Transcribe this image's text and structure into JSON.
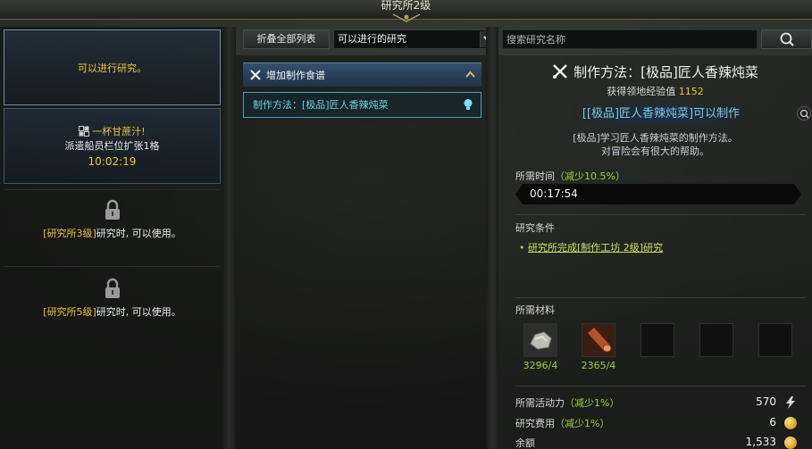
{
  "window": {
    "title": "研究所2级"
  },
  "left_panel": {
    "slot1": {
      "text": "可以进行研究。"
    },
    "slot2": {
      "title": "一杯甘蔗汁!",
      "desc": "派遣船员栏位扩张1格",
      "timer": "10:02:19"
    },
    "slot3": {
      "highlight": "[研究所3级]",
      "text": "研究时, 可以使用。"
    },
    "slot4": {
      "highlight": "[研究所5级]",
      "text": "研究时, 可以使用。"
    }
  },
  "toolbar": {
    "collapse_label": "折叠全部列表",
    "filter_value": "可以进行的研究",
    "search_placeholder": "搜索研究名称"
  },
  "list": {
    "category": "增加制作食谱",
    "items": [
      {
        "label": "制作方法：[极品]匠人香辣炖菜"
      }
    ]
  },
  "detail": {
    "title": "制作方法：[极品]匠人香辣炖菜",
    "exp_label": "获得领地经验值",
    "exp_value": "1152",
    "unlock_text": "[[极品]匠人香辣炖菜]可以制作",
    "desc_line1": "[极品]学习匠人香辣炖菜的制作方法。",
    "desc_line2": "对冒险会有很大的帮助。",
    "time_label": "所需时间",
    "time_reduce": "（减少10.5%）",
    "time_value": "00:17:54",
    "cond_title": "研究条件",
    "cond_item": "研究所完成[制作工坊 2级]研究",
    "materials_title": "所需材料",
    "materials": [
      {
        "icon": "ore-icon",
        "count": "3296/4"
      },
      {
        "icon": "timber-icon",
        "count": "2365/4"
      }
    ],
    "energy_label": "所需活动力",
    "energy_reduce": "（减少1%）",
    "energy_value": "570",
    "cost_label": "研究费用",
    "cost_reduce": "（减少1%）",
    "cost_value": "6",
    "balance_label": "余额",
    "balance_value": "1,533"
  },
  "colors": {
    "accent_yellow": "#f0c239",
    "accent_green": "#9cd33a",
    "accent_cyan": "#6ed1e6",
    "selected_border": "#6a8fb0"
  }
}
